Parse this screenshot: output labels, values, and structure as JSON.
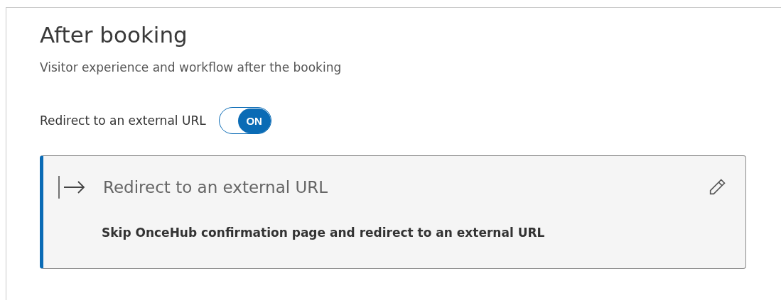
{
  "section": {
    "title": "After booking",
    "subtitle": "Visitor experience and workflow after the booking"
  },
  "redirect_toggle": {
    "label": "Redirect to an external URL",
    "on": true,
    "state_text": "ON"
  },
  "card": {
    "title": "Redirect to an external URL",
    "description": "Skip OnceHub confirmation page and redirect to an external URL"
  }
}
